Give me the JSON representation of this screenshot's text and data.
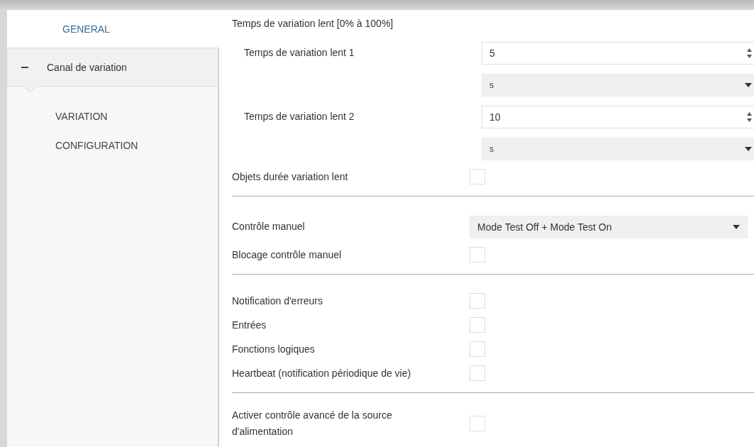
{
  "sidebar": {
    "items": [
      {
        "label": "GENERAL",
        "selected": true
      },
      {
        "label": "Canal de variation",
        "selected": false,
        "expanded": true,
        "children": [
          {
            "label": "VARIATION",
            "selected": false
          },
          {
            "label": "CONFIGURATION",
            "selected": false
          }
        ]
      }
    ]
  },
  "panel": {
    "rows": [
      {
        "kind": "heading",
        "label": "Temps de variation lent [0% à 100%]"
      },
      {
        "kind": "group",
        "items": [
          {
            "kind": "spin",
            "label": "Temps de variation lent 1",
            "value": "5"
          },
          {
            "kind": "select",
            "value": "s"
          },
          {
            "kind": "spin",
            "label": "Temps de variation lent 2",
            "value": "10"
          },
          {
            "kind": "select",
            "value": "s"
          }
        ]
      },
      {
        "kind": "checkbox",
        "label": "Objets durée variation lent",
        "checked": false
      },
      {
        "kind": "divider"
      },
      {
        "kind": "select",
        "label": "Contrôle manuel",
        "value": "Mode Test Off + Mode Test On"
      },
      {
        "kind": "checkbox",
        "label": "Blocage contrôle manuel",
        "checked": false
      },
      {
        "kind": "divider"
      },
      {
        "kind": "checkbox",
        "label": "Notification d'erreurs",
        "checked": false
      },
      {
        "kind": "checkbox",
        "label": "Entrées",
        "checked": false
      },
      {
        "kind": "checkbox",
        "label": "Fonctions logiques",
        "checked": false
      },
      {
        "kind": "checkbox",
        "label": "Heartbeat (notification périodique de vie)",
        "checked": false
      },
      {
        "kind": "divider"
      },
      {
        "kind": "checkbox",
        "label": "Activer contrôle avancé de la source d'alimentation",
        "checked": false
      }
    ]
  }
}
